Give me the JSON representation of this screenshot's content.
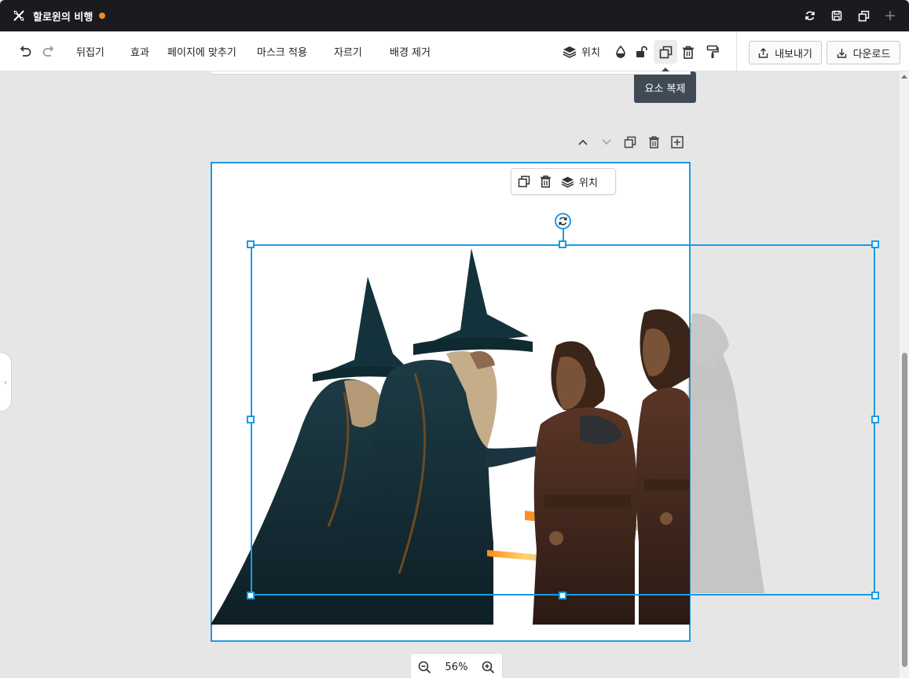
{
  "titlebar": {
    "title": "할로윈의 비행",
    "unsaved_dot_color": "#f08a24",
    "icons": [
      "sync-icon",
      "save-icon",
      "duplicate-window-icon",
      "plus-icon"
    ]
  },
  "toolbar": {
    "undo_icon": "undo-icon",
    "redo_icon": "redo-icon",
    "flip": "뒤집기",
    "effects": "효과",
    "fit_to_page": "페이지에 맞추기",
    "apply_mask": "마스크 적용",
    "crop": "자르기",
    "remove_bg": "배경 제거",
    "position": "위치",
    "export": "내보내기",
    "download": "다운로드"
  },
  "tooltip": {
    "text": "요소 복제"
  },
  "floating_toolbar": {
    "position": "위치"
  },
  "zoom": {
    "value": "56%"
  },
  "colors": {
    "selection": "#1a9be6",
    "titlebar_bg": "#1b1b1f",
    "canvas_bg": "#e6e6e6"
  }
}
